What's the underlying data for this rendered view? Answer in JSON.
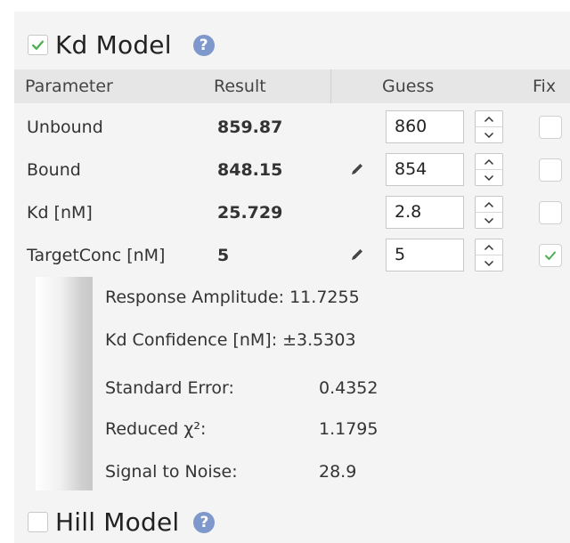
{
  "kd_model": {
    "checked": true,
    "title": "Kd Model",
    "help_glyph": "?"
  },
  "table": {
    "headers": {
      "parameter": "Parameter",
      "result": "Result",
      "guess": "Guess",
      "fix": "Fix"
    },
    "rows": [
      {
        "parameter": "Unbound",
        "result": "859.87",
        "guess": "860",
        "pencil": false,
        "fixed": false
      },
      {
        "parameter": "Bound",
        "result": "848.15",
        "guess": "854",
        "pencil": true,
        "fixed": false
      },
      {
        "parameter": "Kd [nM]",
        "result": "25.729",
        "guess": "2.8",
        "pencil": false,
        "fixed": false
      },
      {
        "parameter": "TargetConc [nM]",
        "result": "5",
        "guess": "5",
        "pencil": true,
        "fixed": true
      }
    ]
  },
  "stats": {
    "response_amplitude": "Response Amplitude: 11.7255",
    "kd_confidence": "Kd Confidence [nM]: ±3.5303",
    "standard_error_label": "Standard Error:",
    "standard_error_value": "0.4352",
    "reduced_chi2_label": "Reduced χ²:",
    "reduced_chi2_value": "1.1795",
    "signal_to_noise_label": "Signal to Noise:",
    "signal_to_noise_value": "28.9"
  },
  "hill_model": {
    "checked": false,
    "title": "Hill Model",
    "help_glyph": "?"
  },
  "colors": {
    "check": "#4caf50",
    "help": "#7f98cc",
    "header_bg": "#e6e6e6",
    "panel_bg": "#f4f4f4"
  },
  "icons": {
    "pencil": "pencil-icon",
    "check": "checkmark-icon",
    "help": "help-icon",
    "up": "chevron-up-icon",
    "down": "chevron-down-icon"
  }
}
